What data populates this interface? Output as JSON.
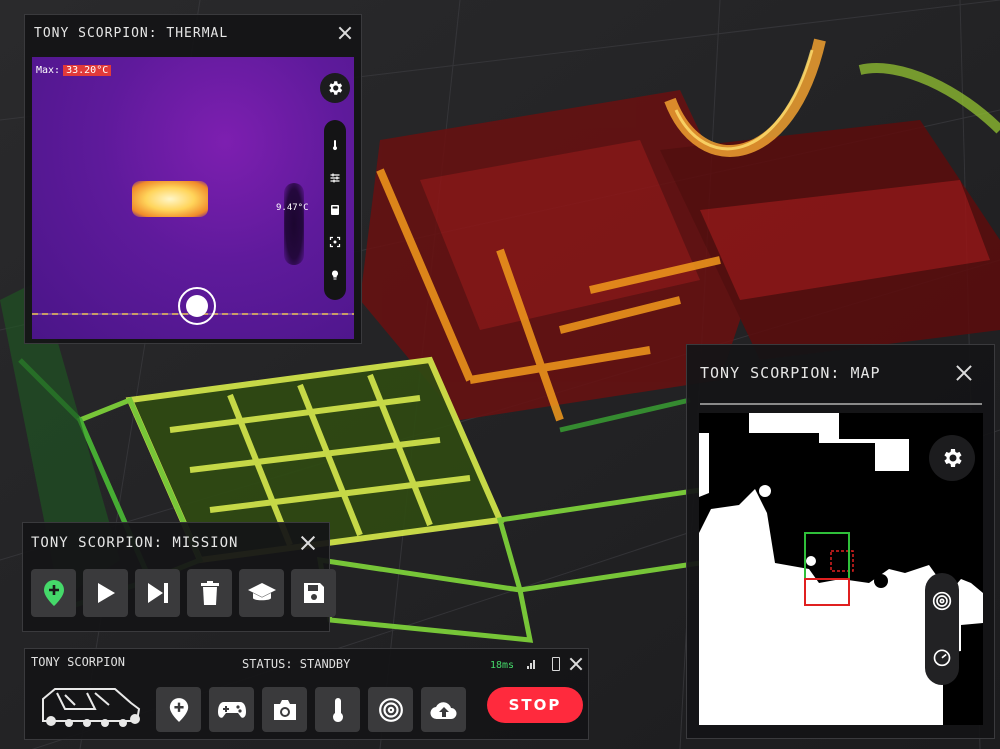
{
  "thermal": {
    "title": "TONY SCORPION: THERMAL",
    "max_label": "Max:",
    "max_value": "33.20°C",
    "spot_temp": "9.47°C",
    "icons": [
      "gear-icon",
      "thermometer-icon",
      "sliders-icon",
      "calculator-icon",
      "focus-icon",
      "lightbulb-icon"
    ]
  },
  "map": {
    "title": "TONY SCORPION: MAP",
    "icons": [
      "gear-icon",
      "target-icon",
      "gauge-icon"
    ]
  },
  "mission": {
    "title": "TONY SCORPION: MISSION",
    "tools": [
      {
        "name": "add-waypoint",
        "icon": "location-plus-icon",
        "color": "#45d96a"
      },
      {
        "name": "play",
        "icon": "play-icon"
      },
      {
        "name": "skip-next",
        "icon": "skip-next-icon"
      },
      {
        "name": "delete",
        "icon": "trash-icon"
      },
      {
        "name": "learn",
        "icon": "graduation-cap-icon"
      },
      {
        "name": "save",
        "icon": "floppy-disk-icon"
      }
    ]
  },
  "status_bar": {
    "title": "TONY SCORPION",
    "status": "STATUS: STANDBY",
    "latency": "18ms",
    "stop_label": "STOP",
    "tools": [
      "location-plus-icon",
      "gamepad-icon",
      "camera-icon",
      "thermometer-icon",
      "target-icon",
      "cloud-upload-icon"
    ]
  },
  "colors": {
    "accent_green": "#45d96a",
    "stop_red": "#ff2a3d",
    "panel_bg": "#141416",
    "button_bg": "#3a3a3c"
  }
}
